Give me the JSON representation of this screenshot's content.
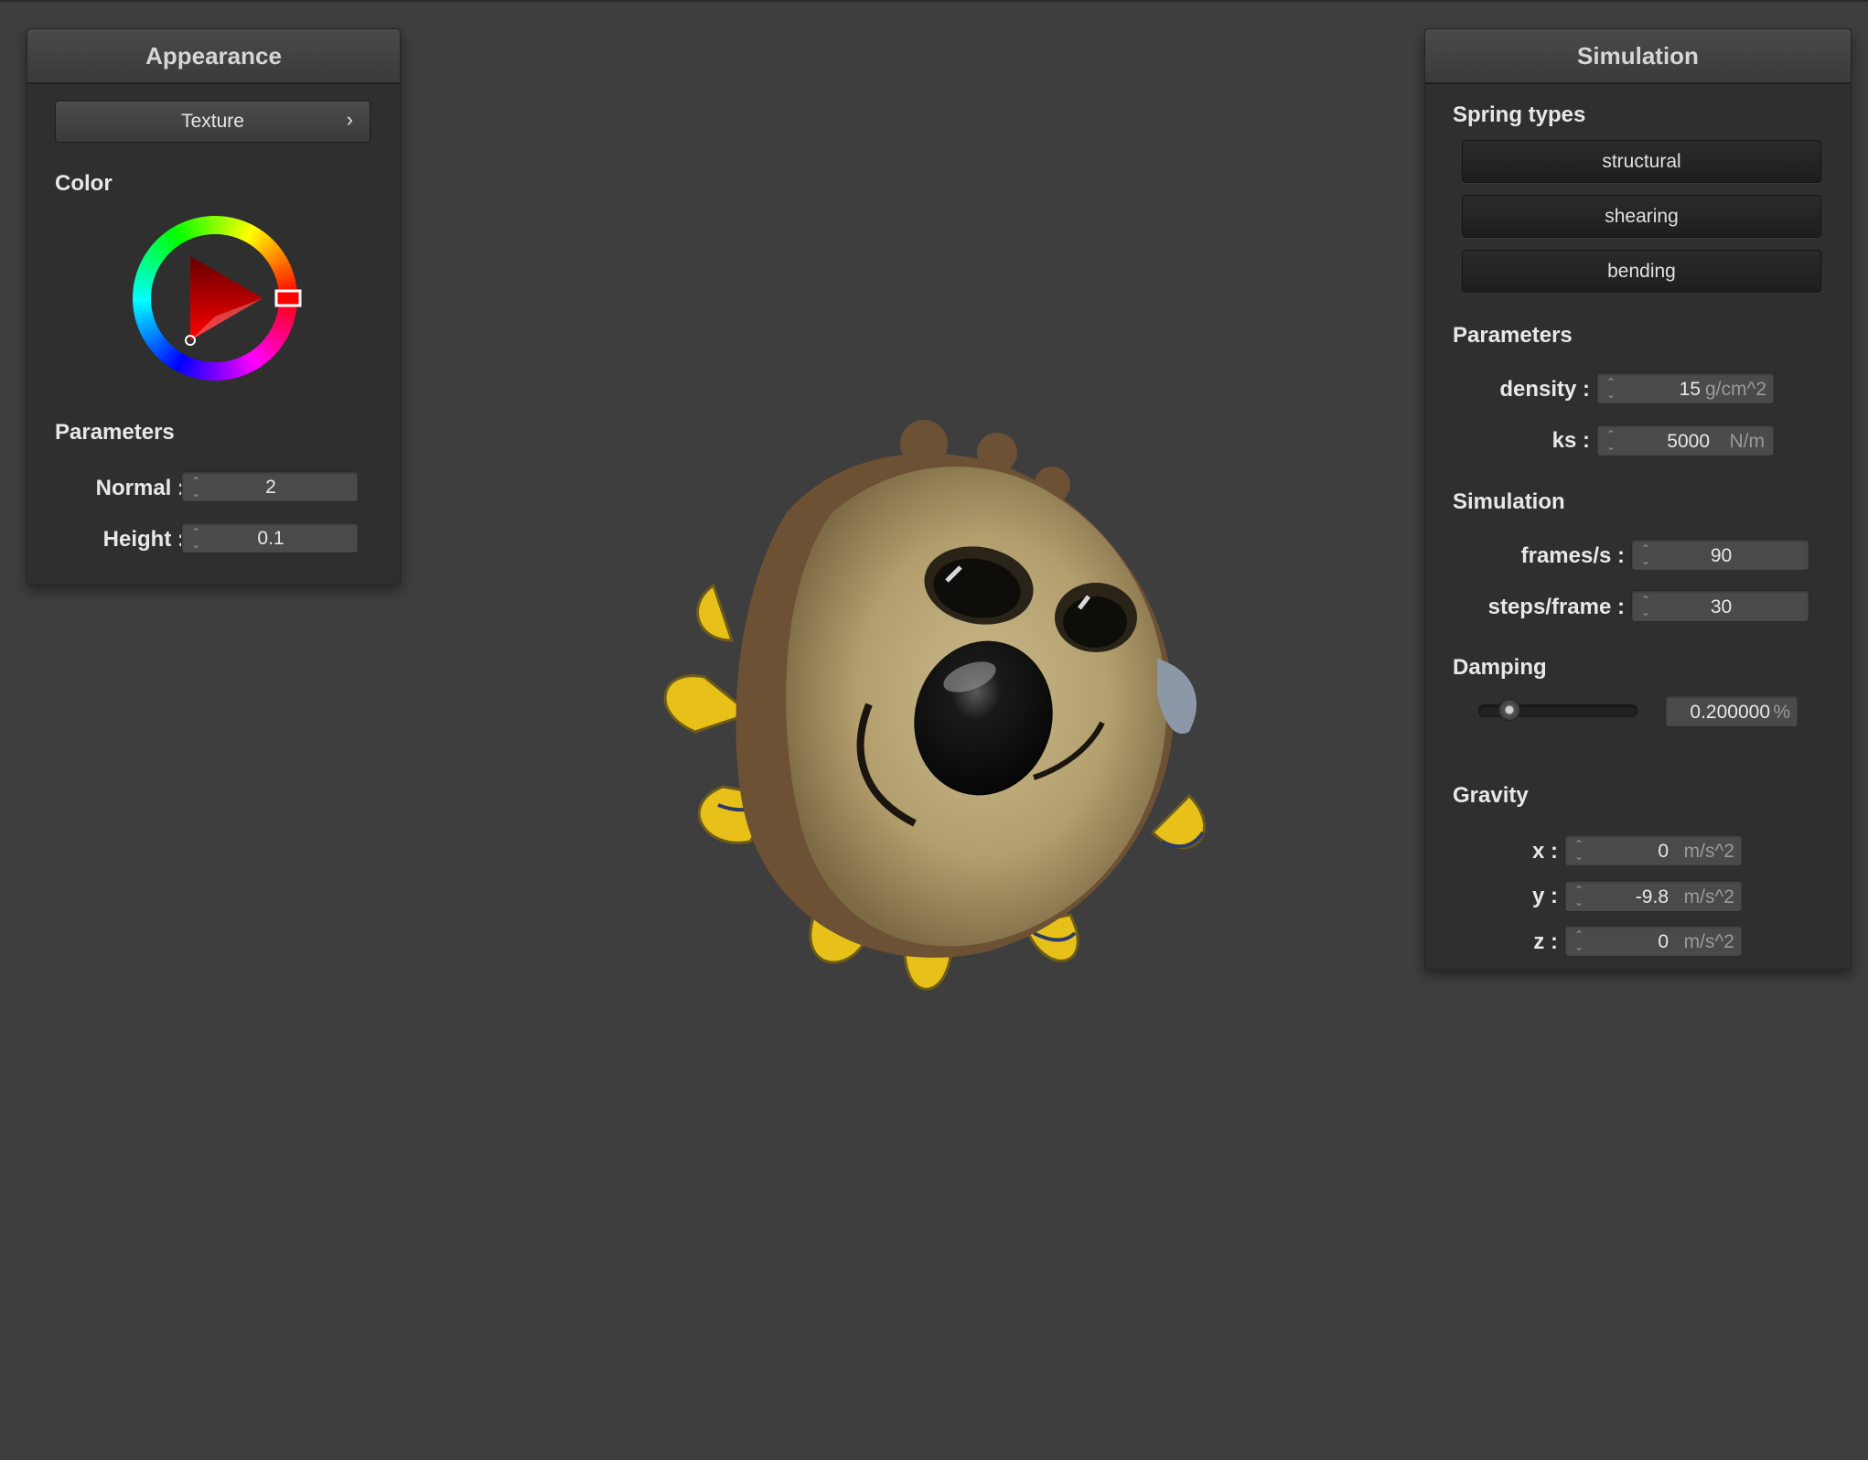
{
  "appearance": {
    "title": "Appearance",
    "texture_button": "Texture",
    "texture_arrow": "›",
    "color_label": "Color",
    "parameters_label": "Parameters",
    "normal_label": "Normal :",
    "normal_value": "2",
    "height_label": "Height :",
    "height_value": "0.1",
    "selected_color": "#ff0000"
  },
  "simulation": {
    "title": "Simulation",
    "spring_types_label": "Spring types",
    "spring_types": [
      "structural",
      "shearing",
      "bending"
    ],
    "parameters_label": "Parameters",
    "density_label": "density :",
    "density_value": "15",
    "density_unit": "g/cm^2",
    "ks_label": "ks :",
    "ks_value": "5000",
    "ks_unit": "N/m",
    "simulation_label": "Simulation",
    "fps_label": "frames/s :",
    "fps_value": "90",
    "steps_label": "steps/frame :",
    "steps_value": "30",
    "damping_label": "Damping",
    "damping_value": "0.200000",
    "damping_unit": "%",
    "damping_fraction": 0.2,
    "gravity_label": "Gravity",
    "gx_label": "x :",
    "gx_value": "0",
    "gy_label": "y :",
    "gy_value": "-9.8",
    "gz_label": "z :",
    "gz_value": "0",
    "gravity_unit": "m/s^2"
  },
  "icons": {
    "spinner": "up-down-arrows",
    "color_wheel": "hue-ring-with-triangle"
  }
}
